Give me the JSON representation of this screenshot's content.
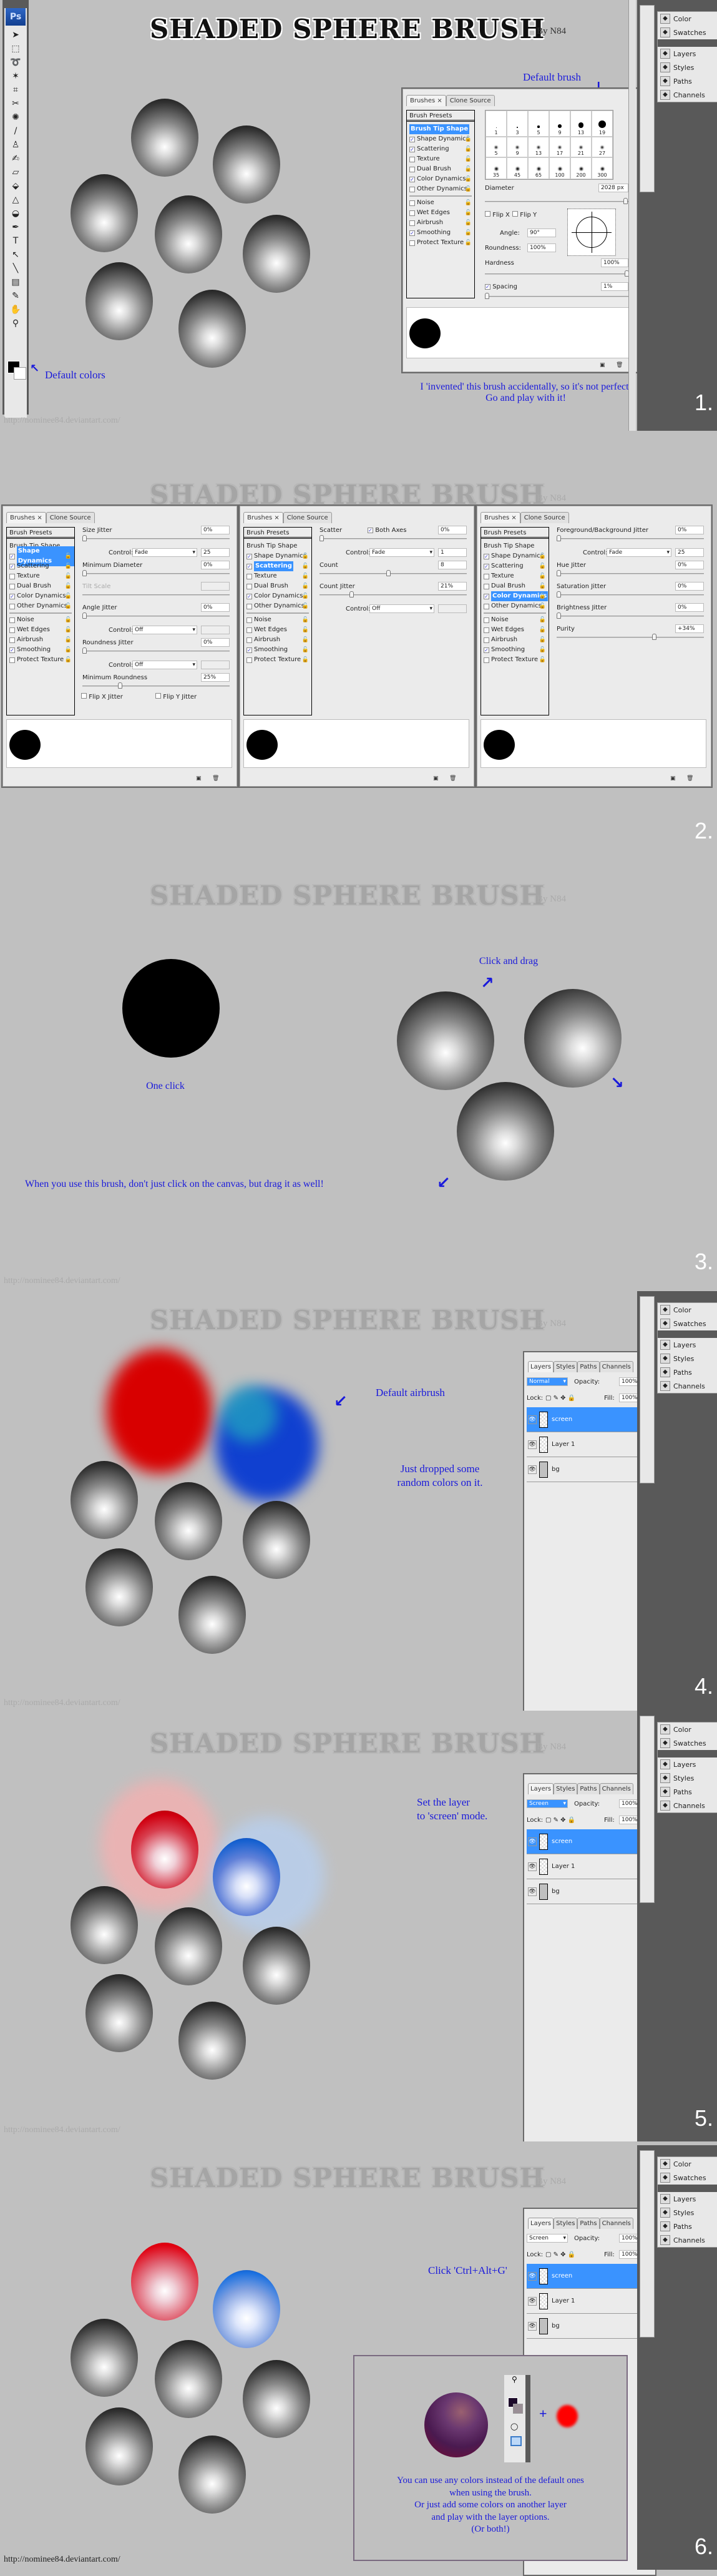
{
  "common": {
    "title": "SHADED SPHERE BRUSH",
    "byline": "By N84",
    "url": "http://nominee84.deviantart.com/"
  },
  "section1": {
    "step": "1.",
    "toolbox": {
      "logo": "Ps",
      "tools": [
        "move-tool",
        "marquee-tool",
        "lasso-tool",
        "magic-wand-tool",
        "crop-tool",
        "slice-tool",
        "healing-brush-tool",
        "brush-tool",
        "clone-stamp-tool",
        "history-brush-tool",
        "eraser-tool",
        "paint-bucket-tool",
        "blur-tool",
        "dodge-tool",
        "pen-tool",
        "type-tool",
        "path-selection-tool",
        "line-tool",
        "notes-tool",
        "eyedropper-tool",
        "hand-tool",
        "zoom-tool"
      ],
      "tool_glyphs": [
        "➤",
        "⬚",
        "➰",
        "✶",
        "⌗",
        "✂",
        "✺",
        "/",
        "♙",
        "✍",
        "▱",
        "⬙",
        "△",
        "◒",
        "✒",
        "T",
        "↖",
        "╲",
        "▤",
        "✎",
        "✋",
        "⚲"
      ],
      "foreground_color": "#000000",
      "background_color": "#ffffff"
    },
    "dock": {
      "items": [
        {
          "label": "Color",
          "icon": "palette-icon"
        },
        {
          "label": "Swatches",
          "icon": "grid-icon"
        },
        {
          "label": "Layers",
          "icon": "layers-icon"
        },
        {
          "label": "Styles",
          "icon": "fx-icon"
        },
        {
          "label": "Paths",
          "icon": "paths-icon"
        },
        {
          "label": "Channels",
          "icon": "channels-icon"
        }
      ]
    },
    "notes": {
      "default_brush": "Default brush",
      "default_colors": "Default colors",
      "invented_line1": "I 'invented' this brush accidentally, so it's not perfect.",
      "invented_line2": "Go and play with it!"
    },
    "brushes_panel": {
      "tabs": [
        "Brushes",
        "Clone Source"
      ],
      "presets_header": "Brush Presets",
      "selected": "Brush Tip Shape",
      "preset_sizes": [
        "1",
        "3",
        "5",
        "9",
        "13",
        "19",
        "5",
        "9",
        "13",
        "17",
        "21",
        "27",
        "35",
        "45",
        "65",
        "100",
        "200",
        "300"
      ],
      "diameter_label": "Diameter",
      "diameter_value": "2028 px",
      "flip_x": "Flip X",
      "flip_y": "Flip Y",
      "angle_label": "Angle:",
      "angle_value": "90°",
      "roundness_label": "Roundness:",
      "roundness_value": "100%",
      "hardness_label": "Hardness",
      "hardness_value": "100%",
      "spacing_label": "Spacing",
      "spacing_value": "1%",
      "spacing_checked": true
    }
  },
  "brush_options": [
    {
      "label": "Shape Dynamics",
      "checked": true
    },
    {
      "label": "Scattering",
      "checked": true
    },
    {
      "label": "Texture",
      "checked": false
    },
    {
      "label": "Dual Brush",
      "checked": false
    },
    {
      "label": "Color Dynamics",
      "checked": true
    },
    {
      "label": "Other Dynamics",
      "checked": false
    },
    {
      "label": "Noise",
      "checked": false
    },
    {
      "label": "Wet Edges",
      "checked": false
    },
    {
      "label": "Airbrush",
      "checked": false
    },
    {
      "label": "Smoothing",
      "checked": true
    },
    {
      "label": "Protect Texture",
      "checked": false
    }
  ],
  "section2": {
    "step": "2.",
    "panels": [
      {
        "selected": "Shape Dynamics",
        "fields": [
          {
            "label": "Size Jitter",
            "value": "0%",
            "slider": 0
          },
          {
            "label": "Control:",
            "select": "Fade",
            "value": "25"
          },
          {
            "label": "Minimum Diameter",
            "value": "0%",
            "slider": 0
          },
          {
            "label": "Tilt Scale",
            "value": "",
            "disabled": true
          },
          {
            "label": "Angle Jitter",
            "value": "0%",
            "slider": 0
          },
          {
            "label": "Control:",
            "select": "Off",
            "value": ""
          },
          {
            "label": "Roundness Jitter",
            "value": "0%",
            "slider": 0
          },
          {
            "label": "Control:",
            "select": "Off",
            "value": ""
          },
          {
            "label": "Minimum Roundness",
            "value": "25%",
            "slider": 0.25
          }
        ],
        "flip_x_jitter": "Flip X Jitter",
        "flip_y_jitter": "Flip Y Jitter"
      },
      {
        "selected": "Scattering",
        "fields": [
          {
            "label": "Scatter",
            "value": "0%",
            "slider": 0,
            "both_axes": "Both Axes"
          },
          {
            "label": "Control:",
            "select": "Fade",
            "value": "1"
          },
          {
            "label": "Count",
            "value": "8",
            "slider": 0.47
          },
          {
            "label": "Count Jitter",
            "value": "21%",
            "slider": 0.21
          },
          {
            "label": "Control:",
            "select": "Off",
            "value": ""
          }
        ]
      },
      {
        "selected": "Color Dynamics",
        "fields": [
          {
            "label": "Foreground/Background Jitter",
            "value": "0%",
            "slider": 0
          },
          {
            "label": "Control:",
            "select": "Fade",
            "value": "25"
          },
          {
            "label": "Hue Jitter",
            "value": "0%",
            "slider": 0
          },
          {
            "label": "Saturation Jitter",
            "value": "0%",
            "slider": 0
          },
          {
            "label": "Brightness Jitter",
            "value": "0%",
            "slider": 0
          },
          {
            "label": "Purity",
            "value": "+34%",
            "slider": 0.67
          }
        ]
      }
    ]
  },
  "section3": {
    "step": "3.",
    "one_click": "One click",
    "click_and_drag": "Click and drag",
    "tip": "When you use this brush, don't just click on the canvas, but drag it as well!"
  },
  "layers_panel": {
    "tabs": [
      "Layers",
      "Styles",
      "Paths",
      "Channels"
    ],
    "opacity_label": "Opacity:",
    "opacity_value": "100%",
    "lock_label": "Lock:",
    "fill_label": "Fill:",
    "fill_value": "100%",
    "layers": [
      "screen",
      "Layer 1",
      "bg"
    ]
  },
  "section4": {
    "step": "4.",
    "blend_mode": "Normal",
    "default_airbrush": "Default airbrush",
    "dropped_line1": "Just dropped some",
    "dropped_line2": "random colors on it."
  },
  "section5": {
    "step": "5.",
    "blend_mode": "Screen",
    "set_line1": "Set the layer",
    "set_line2": "to 'screen' mode."
  },
  "section6": {
    "step": "6.",
    "blend_mode": "Screen",
    "shortcut": "Click 'Ctrl+Alt+G'",
    "plus": "+",
    "info_lines": [
      "You can use any colors instead of the default ones",
      "when using the brush.",
      "Or just add some colors on another layer",
      "and play with the layer options.",
      "(Or both!)"
    ],
    "fg_color": "#1d0a2a",
    "bg_color": "#9a8f96",
    "accent_red": "#ff0000"
  },
  "colors": {
    "annotation_blue": "#1a1adb",
    "selection_blue": "#3a93ff",
    "canvas_gray": "#c0c0c0"
  }
}
